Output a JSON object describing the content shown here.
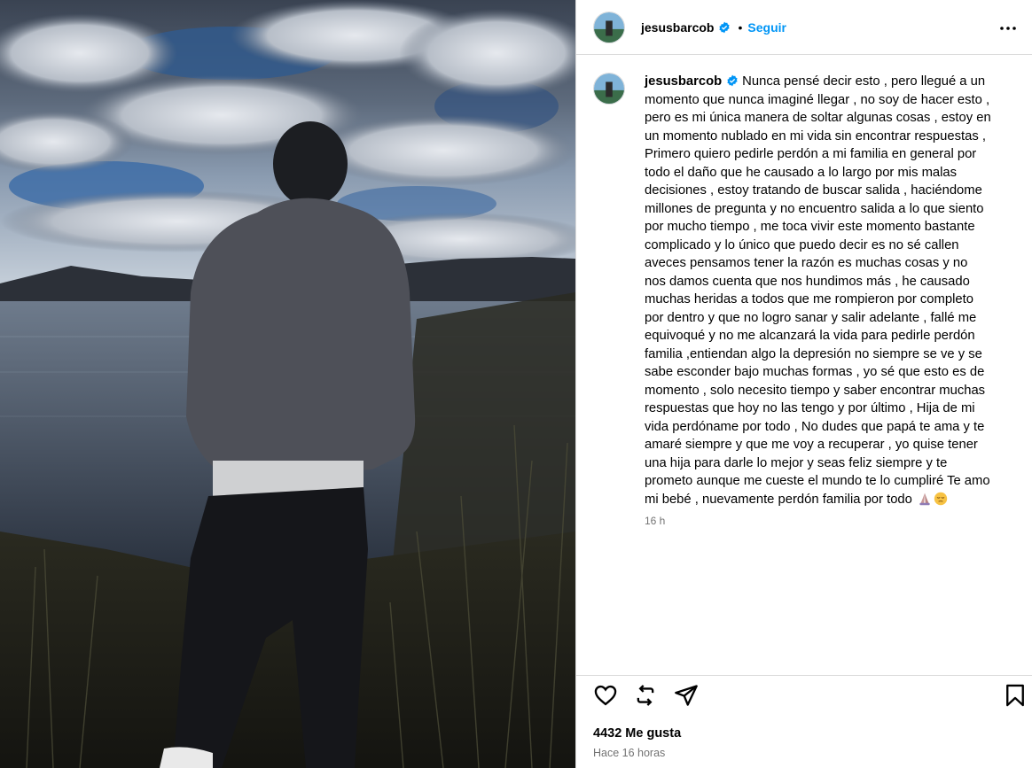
{
  "photo": {
    "alt_icon": "photo-man-by-lake"
  },
  "header": {
    "username": "jesusbarcob",
    "separator": "•",
    "follow_label": "Seguir",
    "more_icon": "more-options-icon"
  },
  "caption": {
    "username": "jesusbarcob",
    "text": "Nunca pensé decir esto , pero llegué a un momento que nunca imaginé llegar , no soy de hacer esto , pero es mi única manera de soltar algunas cosas , estoy en un momento nublado en mi vida sin encontrar respuestas , Primero quiero pedirle perdón a mi familia en general por todo el daño que he causado a lo largo por mis malas decisiones , estoy tratando de buscar salida , haciéndome millones de pregunta y no encuentro salida a lo que siento por mucho tiempo , me toca vivir este momento bastante complicado y lo único que puedo decir es no sé callen aveces pensamos tener la razón es muchas cosas y no nos damos cuenta que nos hundimos más , he causado muchas heridas a todos que me rompieron por completo por dentro y que no logro sanar y salir adelante , fallé me equivoqué y no me alcanzará la vida para pedirle perdón familia ,entiendan algo la depresión no siempre se ve y se sabe esconder bajo muchas formas , yo sé que esto es de momento , solo necesito tiempo y saber encontrar muchas respuestas que hoy no las tengo y por último , Hija de mi vida perdóname por todo , No dudes que papá te ama y te amaré siempre y que me voy a recuperar , yo quise tener una hija para darle lo mejor y seas feliz siempre y te prometo aunque me cueste el mundo te lo cumpliré Te amo mi bebé , nuevamente perdón familia por todo",
    "emojis": [
      "praying-hands-emoji",
      "pensive-face-emoji"
    ],
    "time": "16 h"
  },
  "actions": {
    "like_icon": "heart-icon",
    "comment_icon": "repost-icon",
    "share_icon": "send-icon",
    "save_icon": "bookmark-icon",
    "likes": "4432 Me gusta",
    "ago": "Hace 16 horas"
  },
  "colors": {
    "accent": "#0095f6",
    "verified": "#0095f6",
    "muted": "#737373",
    "border": "#dbdbdb"
  }
}
